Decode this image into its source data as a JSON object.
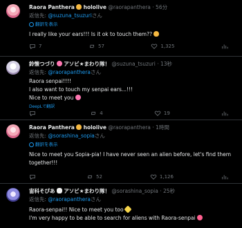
{
  "posts": [
    {
      "name": "Raora Panthera",
      "badge": "hololive",
      "handle": "@raorapanthera",
      "time": "· 56分",
      "reply_prefix": "返信先:",
      "reply_to": "@suzuna_tsuzuri",
      "reply_suffix": "さん",
      "translate": "翻訳を表示",
      "text": "I really like your ears!!! Is it ok to touch them??",
      "counts": {
        "reply": "7",
        "repost": "57",
        "like": "1,325",
        "views": ""
      }
    },
    {
      "name": "鈴懐つづり",
      "suffix_text": "アソビ★まわり隊！",
      "handle": "@suzuna_tsuzuri",
      "time": "· 13秒",
      "reply_prefix": "返信先:",
      "reply_to": "@raorapanthera",
      "reply_suffix": "さん",
      "text_lines": [
        "Raora senpai!!!!",
        "I also want to touch my senpai ears...!!!",
        "Nice to meet you"
      ],
      "deepl": "DeepLで翻訳",
      "counts": {
        "reply": "",
        "repost": "4",
        "like": "19",
        "views": ""
      }
    },
    {
      "name": "Raora Panthera",
      "badge": "hololive",
      "handle": "@raorapanthera",
      "time": "· 1時間",
      "reply_prefix": "返信先:",
      "reply_to": "@sorashina_sopia",
      "reply_suffix": "さん",
      "translate": "翻訳を表示",
      "text": "Nice to meet you Sopia-pia!  I have never seen an alien before, let's find them together!!!",
      "counts": {
        "reply": "",
        "repost": "52",
        "like": "1,126",
        "views": ""
      }
    },
    {
      "name": "宙科そぴあ",
      "suffix_text": "アソビ★まわり隊！",
      "handle": "@sorashina_sopia",
      "time": "· 25秒",
      "reply_prefix": "返信先:",
      "reply_to": "@raorapanthera",
      "reply_suffix": "さん",
      "text_lines": [
        "Raora-senpai!! Nice to meet you too",
        "I'm very happy to be able to search for aliens with Raora-senpai"
      ],
      "counts": {
        "reply": "",
        "repost": "",
        "like": "",
        "views": ""
      }
    }
  ],
  "icons": [
    "reply-icon",
    "repost-icon",
    "like-icon",
    "views-icon"
  ]
}
